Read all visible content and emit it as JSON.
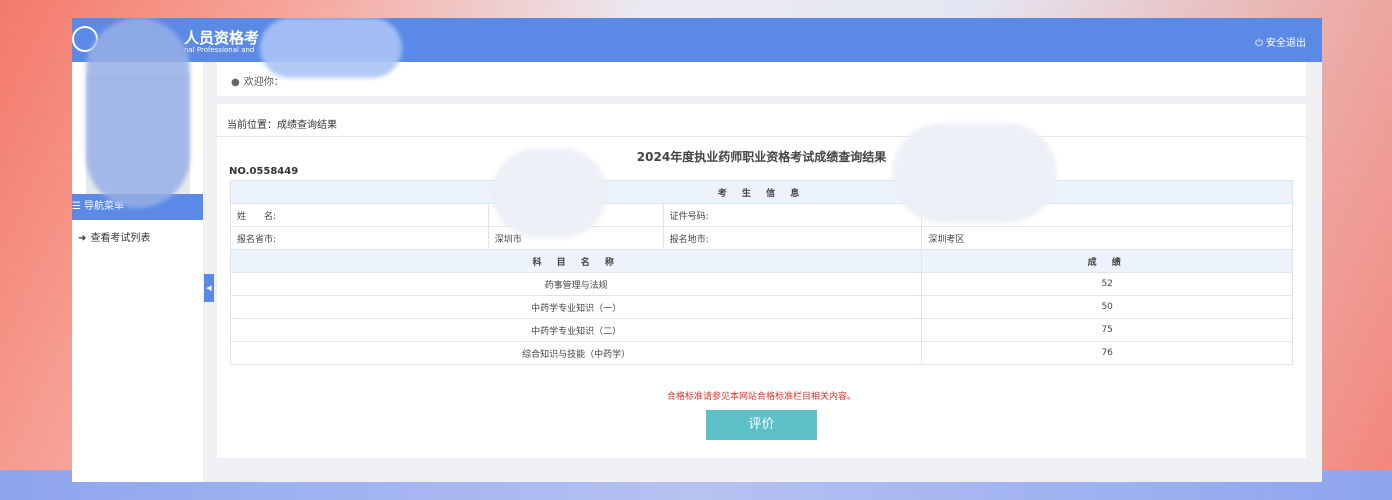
{
  "header": {
    "title": "人员资格考",
    "subtitle": "nal Professional and",
    "logout_label": "安全退出"
  },
  "sidebar": {
    "nav_header": "导航菜单",
    "items": [
      {
        "label": "查看考试列表"
      }
    ]
  },
  "welcome": {
    "text": "欢迎你："
  },
  "breadcrumb": {
    "label": "当前位置：成绩查询结果"
  },
  "result": {
    "title": "2024年度执业药师职业资格考试成绩查询结果",
    "cert_no": "NO.0558449",
    "info_header": "考 生 信 息",
    "info_rows": [
      [
        "姓　　名:",
        "",
        "证件号码:",
        ""
      ],
      [
        "报名省市:",
        "深圳市",
        "报名地市:",
        "深圳考区"
      ]
    ],
    "subject_header": "科 目 名 称",
    "score_header": "成 绩",
    "scores": [
      {
        "subject": "药事管理与法规",
        "score": "52"
      },
      {
        "subject": "中药学专业知识（一）",
        "score": "50"
      },
      {
        "subject": "中药学专业知识（二）",
        "score": "75"
      },
      {
        "subject": "综合知识与技能（中药学）",
        "score": "76"
      }
    ],
    "note": "合格标准请参见本网站合格标准栏目相关内容。",
    "rate_button": "评价"
  },
  "colors": {
    "primary": "#5b8ae6",
    "button": "#5cc1c7",
    "note": "#d9342b"
  }
}
